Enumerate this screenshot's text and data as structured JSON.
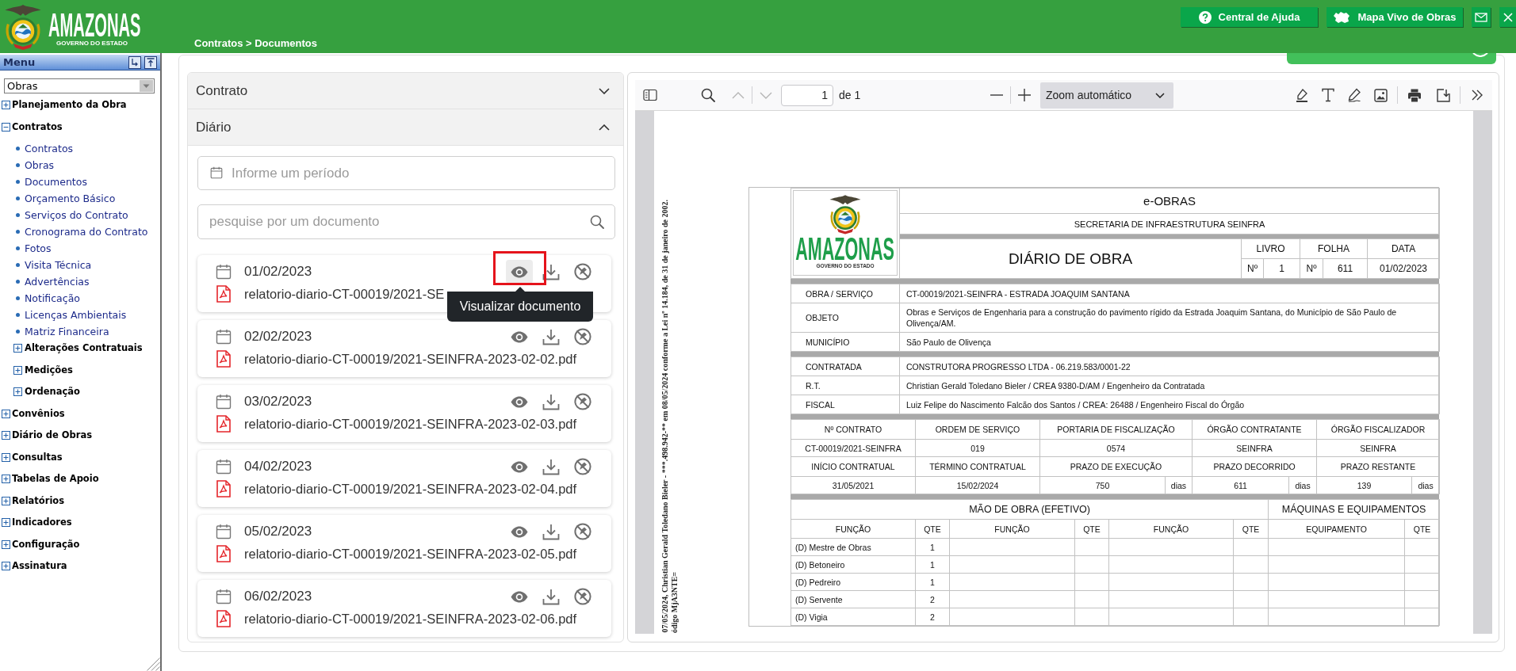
{
  "header": {
    "logo": {
      "title": "AMAZONAS",
      "subtitle": "GOVERNO DO ESTADO"
    },
    "breadcrumb": "Contratos > Documentos",
    "buttons": [
      {
        "kind": "help",
        "label": "Central de Ajuda"
      },
      {
        "kind": "map",
        "label": "Mapa Vivo de Obras"
      },
      {
        "kind": "mail"
      },
      {
        "kind": "close"
      }
    ]
  },
  "sidebar": {
    "title": "Menu",
    "module_select": {
      "value": "Obras"
    },
    "items": [
      {
        "kind": "group",
        "label": "Planejamento da Obra",
        "expanded": false
      },
      {
        "kind": "group",
        "label": "Contratos",
        "expanded": true,
        "children": [
          {
            "kind": "link",
            "label": "Contratos"
          },
          {
            "kind": "link",
            "label": "Obras"
          },
          {
            "kind": "link",
            "label": "Documentos"
          },
          {
            "kind": "link",
            "label": "Orçamento Básico"
          },
          {
            "kind": "link",
            "label": "Serviços do Contrato"
          },
          {
            "kind": "link",
            "label": "Cronograma do Contrato"
          },
          {
            "kind": "link",
            "label": "Fotos"
          },
          {
            "kind": "link",
            "label": "Visita Técnica"
          },
          {
            "kind": "link",
            "label": "Advertências"
          },
          {
            "kind": "link",
            "label": "Notificação"
          },
          {
            "kind": "link",
            "label": "Licenças Ambientais"
          },
          {
            "kind": "link",
            "label": "Matriz Financeira"
          },
          {
            "kind": "group",
            "label": "Alterações Contratuais",
            "expanded": false
          },
          {
            "kind": "group",
            "label": "Medições",
            "expanded": false
          },
          {
            "kind": "group",
            "label": "Ordenação",
            "expanded": false
          }
        ]
      },
      {
        "kind": "group",
        "label": "Convênios",
        "expanded": false
      },
      {
        "kind": "group",
        "label": "Diário de Obras",
        "expanded": false
      },
      {
        "kind": "group",
        "label": "Consultas",
        "expanded": false
      },
      {
        "kind": "group",
        "label": "Tabelas de Apoio",
        "expanded": false
      },
      {
        "kind": "group",
        "label": "Relatórios",
        "expanded": false
      },
      {
        "kind": "group",
        "label": "Indicadores",
        "expanded": false
      },
      {
        "kind": "group",
        "label": "Configuração",
        "expanded": false
      },
      {
        "kind": "group",
        "label": "Assinatura",
        "expanded": false
      }
    ]
  },
  "accordion": [
    {
      "title": "Contrato",
      "expanded": false
    },
    {
      "title": "Diário",
      "expanded": true,
      "period_field": {
        "placeholder": "Informe um período"
      },
      "search_field": {
        "placeholder": "pesquise por um documento"
      },
      "documents": [
        {
          "date": "01/02/2023",
          "file": "relatorio-diario-CT-00019/2021-SE",
          "view_hovered": true,
          "annotated": true,
          "tooltip": "Visualizar documento"
        },
        {
          "date": "02/02/2023",
          "file": "relatorio-diario-CT-00019/2021-SEINFRA-2023-02-02.pdf",
          "view_hovered": false,
          "annotated": false
        },
        {
          "date": "03/02/2023",
          "file": "relatorio-diario-CT-00019/2021-SEINFRA-2023-02-03.pdf",
          "view_hovered": false,
          "annotated": false
        },
        {
          "date": "04/02/2023",
          "file": "relatorio-diario-CT-00019/2021-SEINFRA-2023-02-04.pdf",
          "view_hovered": false,
          "annotated": false
        },
        {
          "date": "05/02/2023",
          "file": "relatorio-diario-CT-00019/2021-SEINFRA-2023-02-05.pdf",
          "view_hovered": false,
          "annotated": false
        },
        {
          "date": "06/02/2023",
          "file": "relatorio-diario-CT-00019/2021-SEINFRA-2023-02-06.pdf",
          "view_hovered": false,
          "annotated": false
        }
      ]
    }
  ],
  "pdf_viewer": {
    "toolbar": {
      "previous_disabled": true,
      "next_disabled": true,
      "page": "1",
      "page_count": "de 1",
      "zoom": "Zoom automático"
    },
    "stamp_lines": [
      "07/05/2024, Christian Gerald Toledano Bieler - ***.498.942-** em 08/05/2024 conforme a Lei nº 14.184, de 31 de janeiro de 2002.",
      "ódigo MjA3NTE="
    ],
    "document": {
      "logo": {
        "title": "AMAZONAS",
        "subtitle": "GOVERNO DO ESTADO"
      },
      "system": "e-OBRAS",
      "department": "SECRETARIA DE INFRAESTRUTURA SEINFRA",
      "title": "DIÁRIO DE OBRA",
      "register": [
        {
          "label": "LIVRO",
          "number_label": "Nº",
          "value": "1"
        },
        {
          "label": "FOLHA",
          "number_label": "Nº",
          "value": "611"
        },
        {
          "label": "DATA",
          "value": "01/02/2023"
        }
      ],
      "info_sections": [
        [
          {
            "label": "OBRA / SERVIÇO",
            "value": "CT-00019/2021-SEINFRA - ESTRADA JOAQUIM SANTANA"
          },
          {
            "label": "OBJETO",
            "value": "Obras e Serviços de Engenharia para a construção do pavimento rígido da Estrada Joaquim Santana, do Município de São Paulo de Olivença/AM."
          },
          {
            "label": "MUNICÍPIO",
            "value": "São Paulo de Olivença"
          }
        ],
        [
          {
            "label": "CONTRATADA",
            "value": "CONSTRUTORA PROGRESSO LTDA - 06.219.583/0001-22"
          },
          {
            "label": "R.T.",
            "value": "Christian Gerald Toledano Bieler / CREA 9380-D/AM / Engenheiro da Contratada"
          },
          {
            "label": "FISCAL",
            "value": "Luiz Felipe do Nascimento Falcão dos Santos / CREA: 26488 / Engenheiro Fiscal do Órgão"
          }
        ]
      ],
      "contract_rows": [
        {
          "kind": "header",
          "cells": [
            {
              "text": "Nº CONTRATO"
            },
            {
              "text": "ORDEM DE SERVIÇO"
            },
            {
              "text": "PORTARIA DE FISCALIZAÇÃO"
            },
            {
              "text": "ÓRGÃO CONTRATANTE"
            },
            {
              "text": "ÓRGÃO FISCALIZADOR"
            }
          ]
        },
        {
          "kind": "values",
          "cells": [
            {
              "text": "CT-00019/2021-SEINFRA"
            },
            {
              "text": "019"
            },
            {
              "text": "0574"
            },
            {
              "text": "SEINFRA"
            },
            {
              "text": "SEINFRA"
            }
          ]
        },
        {
          "kind": "header",
          "cells": [
            {
              "text": "INÍCIO CONTRATUAL"
            },
            {
              "text": "TÉRMINO CONTRATUAL"
            },
            {
              "text": "PRAZO DE EXECUÇÃO"
            },
            {
              "text": "PRAZO DECORRIDO"
            },
            {
              "text": "PRAZO RESTANTE"
            }
          ]
        },
        {
          "kind": "values",
          "cells": [
            {
              "text": "31/05/2021"
            },
            {
              "text": "15/02/2024"
            },
            {
              "text": "750",
              "unit": "dias"
            },
            {
              "text": "611",
              "unit": "dias"
            },
            {
              "text": "139",
              "unit": "dias"
            }
          ]
        }
      ],
      "workforce": {
        "title": "MÃO DE OBRA (EFETIVO)",
        "columns": [
          "FUNÇÃO",
          "QTE",
          "FUNÇÃO",
          "QTE",
          "FUNÇÃO",
          "QTE"
        ],
        "rows": [
          {
            "function": "(D) Mestre de Obras",
            "qty": "1"
          },
          {
            "function": "(D) Betoneiro",
            "qty": "1"
          },
          {
            "function": "(D) Pedreiro",
            "qty": "1"
          },
          {
            "function": "(D) Servente",
            "qty": "2"
          },
          {
            "function": "(D) Vigia",
            "qty": "2"
          }
        ]
      },
      "equipment": {
        "title": "MÁQUINAS E EQUIPAMENTOS",
        "columns": [
          "EQUIPAMENTO",
          "QTE"
        ]
      }
    }
  }
}
